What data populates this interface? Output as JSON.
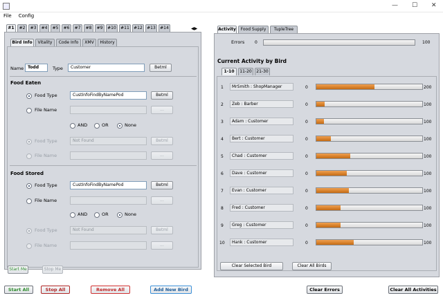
{
  "app": {
    "menu": [
      "File",
      "Config"
    ]
  },
  "left": {
    "numbered_tabs": [
      "#1",
      "#2",
      "#3",
      "#4",
      "#5",
      "#6",
      "#7",
      "#8",
      "#9",
      "#10",
      "#11",
      "#12",
      "#13",
      "#14"
    ],
    "sub_tabs": [
      "Bird Info",
      "Vitality",
      "Code Info",
      "XMV",
      "History"
    ],
    "name_label": "Name",
    "name_value": "Todd",
    "type_label": "Type",
    "type_value": "Customer",
    "button_label": "Betml",
    "food_eaten": {
      "header": "Food Eaten",
      "food_type_label": "Food Type",
      "food_type_value": "CustInfoFindByNamePod",
      "file_name_label": "File Name",
      "browse_label": "...",
      "and_label": "AND",
      "or_label": "OR",
      "none_label": "None",
      "food_type_label_2": "Food Type",
      "food_type_value_2": "Not Found",
      "file_name_label_2": "File Name"
    },
    "food_stored": {
      "header": "Food Stored",
      "food_type_label": "Food Type",
      "food_type_value": "CustInfoFindByNamePod",
      "file_name_label": "File Name",
      "browse_label": "...",
      "and_label": "AND",
      "or_label": "OR",
      "none_label": "None",
      "food_type_label_2": "Food Type",
      "food_type_value_2": "Not Found",
      "file_name_label_2": "File Name"
    },
    "start_me": "Start Me",
    "stop_me": "Stop Me"
  },
  "right": {
    "tabs": [
      "Activity",
      "Food Supply",
      "TupleTree"
    ],
    "errors_label": "Errors",
    "errors_min": "0",
    "errors_max": "100",
    "current_activity_title": "Current Activity by Bird",
    "range_tabs": [
      "1-10",
      "11-20",
      "21-30"
    ],
    "rows": [
      {
        "idx": "1",
        "name": "MrSmith : ShopManager",
        "min": "0",
        "max": "200",
        "level": 0.55
      },
      {
        "idx": "2",
        "name": "Zeb : Barber",
        "min": "0",
        "max": "100",
        "level": 0.08
      },
      {
        "idx": "3",
        "name": "Adam : Customer",
        "min": "0",
        "max": "100",
        "level": 0.07
      },
      {
        "idx": "4",
        "name": "Bert : Customer",
        "min": "0",
        "max": "100",
        "level": 0.14
      },
      {
        "idx": "5",
        "name": "Chad : Customer",
        "min": "0",
        "max": "100",
        "level": 0.32
      },
      {
        "idx": "6",
        "name": "Dave : Customer",
        "min": "0",
        "max": "100",
        "level": 0.29
      },
      {
        "idx": "7",
        "name": "Evan : Customer",
        "min": "0",
        "max": "100",
        "level": 0.31
      },
      {
        "idx": "8",
        "name": "Fred : Customer",
        "min": "0",
        "max": "100",
        "level": 0.23
      },
      {
        "idx": "9",
        "name": "Greg : Customer",
        "min": "0",
        "max": "100",
        "level": 0.23
      },
      {
        "idx": "10",
        "name": "Hank : Customer",
        "min": "0",
        "max": "100",
        "level": 0.35
      }
    ],
    "clear_selected": "Clear Selected Bird",
    "clear_all_birds": "Clear All Birds"
  },
  "bottom": {
    "start_all": "Start All",
    "stop_all": "Stop All",
    "remove_all": "Remove All",
    "add_new_bird": "Add New Bird",
    "clear_errors": "Clear Errors",
    "clear_all_activities": "Clear All Activities"
  },
  "colors": {
    "start_all": "#2e8b2e",
    "stop_all": "#c03030",
    "remove_all": "#d03030",
    "add_new_bird": "#3a8fd8",
    "bar_fill": "#dc8a33"
  }
}
